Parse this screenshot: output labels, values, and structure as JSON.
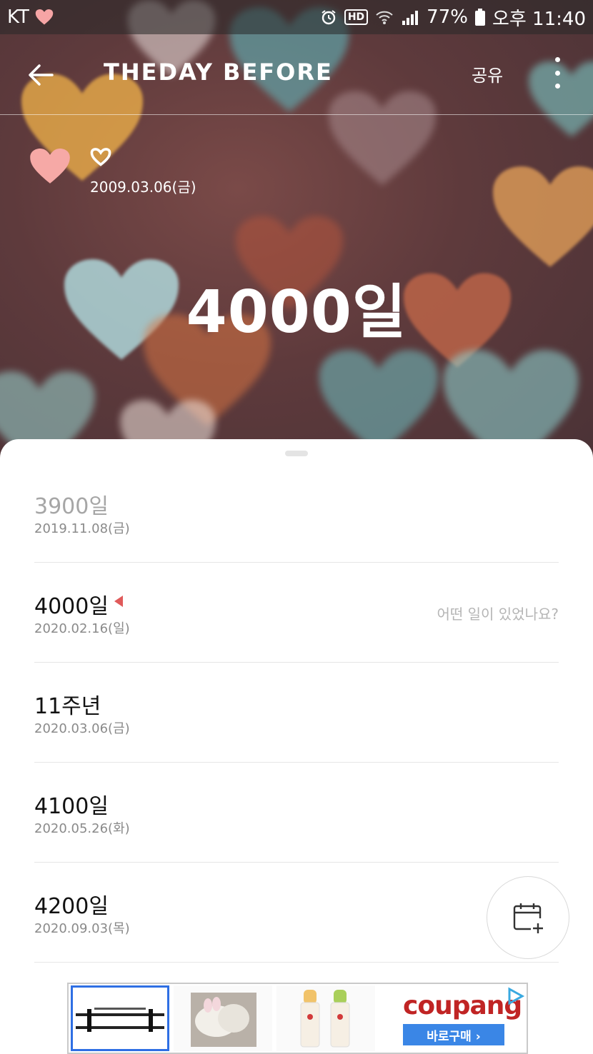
{
  "status_bar": {
    "carrier": "KT",
    "battery": "77%",
    "time": "오후 11:40",
    "hd_badge": "HD"
  },
  "app_bar": {
    "title": "THEDAY BEFORE",
    "share_label": "공유"
  },
  "header": {
    "start_date": "2009.03.06(금)",
    "current_count": "4000일"
  },
  "events": [
    {
      "title": "3900일",
      "date": "2019.11.08(금)",
      "state": "past"
    },
    {
      "title": "4000일",
      "date": "2020.02.16(일)",
      "state": "current",
      "memo_placeholder": "어떤 일이 있었나요?"
    },
    {
      "title": "11주년",
      "date": "2020.03.06(금)",
      "state": "upcoming"
    },
    {
      "title": "4100일",
      "date": "2020.05.26(화)",
      "state": "upcoming"
    },
    {
      "title": "4200일",
      "date": "2020.09.03(목)",
      "state": "upcoming"
    }
  ],
  "fab": {
    "icon": "calendar-add-icon"
  },
  "ad": {
    "brand": "coupang",
    "cta": "바로구매 ›"
  },
  "colors": {
    "marker": "#e05a5a",
    "heart_pink": "#f6a5a5",
    "brand_blue": "#3a86e6",
    "brand_red": "#c02424"
  }
}
